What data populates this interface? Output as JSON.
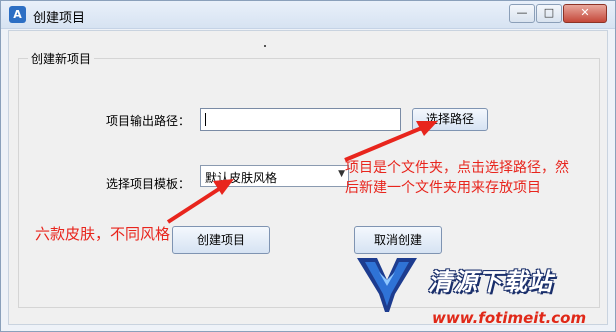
{
  "window": {
    "title": "创建项目",
    "icon": "app-logo-icon"
  },
  "controls": {
    "minimize": "minimize-icon",
    "maximize": "maximize-icon",
    "close": "close-icon"
  },
  "group": {
    "label": "创建新项目"
  },
  "form": {
    "output_path_label": "项目输出路径：",
    "output_path_value": "",
    "browse_button": "选择路径",
    "template_label": "选择项目模板：",
    "template_value": "默认皮肤风格"
  },
  "buttons": {
    "create": "创建项目",
    "cancel": "取消创建"
  },
  "annotations": {
    "note_path_line1": "项目是个文件夹，点击选择路径，然",
    "note_path_line2": "后新建一个文件夹用来存放项目",
    "note_skin": "六款皮肤，不同风格",
    "color": "#e8251d"
  },
  "watermark": {
    "name": "清源下载站",
    "url": "www.fotimeit.com"
  },
  "colors": {
    "accent": "#2d6fc4",
    "annotation": "#e8251d"
  }
}
